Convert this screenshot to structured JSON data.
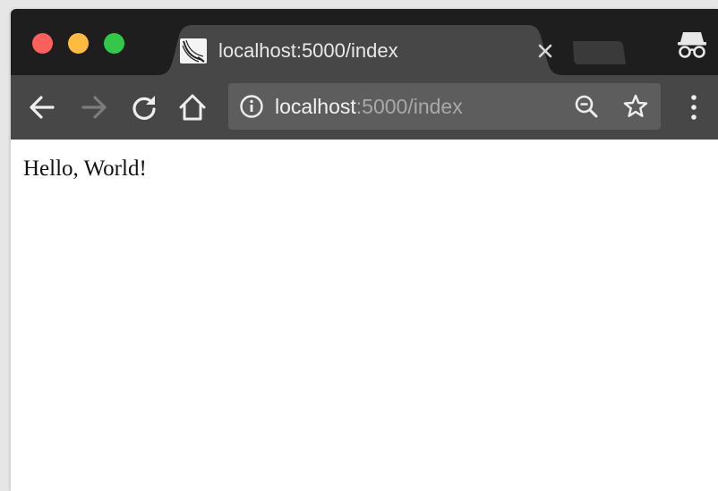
{
  "window": {
    "traffic_lights": {
      "close_color": "#fc605b",
      "minimize_color": "#fdbc40",
      "maximize_color": "#34c84a"
    }
  },
  "tab": {
    "title": "localhost:5000/index",
    "favicon": "flask-icon",
    "close_label": "×"
  },
  "toolbar": {
    "back_icon": "arrow-left-icon",
    "forward_icon": "arrow-right-icon",
    "reload_icon": "reload-icon",
    "home_icon": "home-icon",
    "omnibox": {
      "host": "localhost",
      "path": ":5000/index",
      "info_icon": "info-icon",
      "zoom_icon": "zoom-out-icon",
      "bookmark_icon": "star-icon"
    },
    "menu_icon": "kebab-menu-icon",
    "incognito_icon": "incognito-icon"
  },
  "page": {
    "body_text": "Hello, World!"
  },
  "colors": {
    "tabstrip": "#1e1e1e",
    "active_tab": "#474747",
    "toolbar": "#474747",
    "omnibox": "#5d5d5d"
  }
}
